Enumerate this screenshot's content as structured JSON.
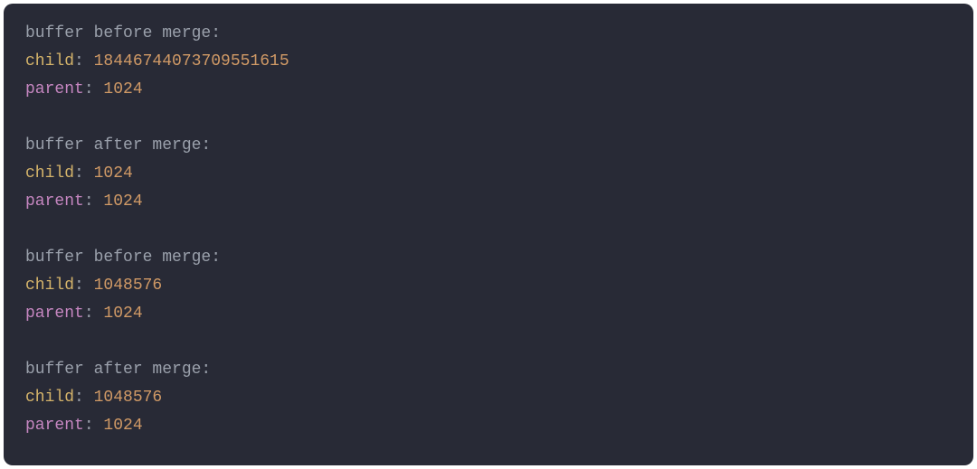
{
  "blocks": [
    {
      "heading": "buffer before merge:",
      "childKey": "child",
      "childValue": "18446744073709551615",
      "parentKey": "parent",
      "parentValue": "1024"
    },
    {
      "heading": "buffer after merge:",
      "childKey": "child",
      "childValue": "1024",
      "parentKey": "parent",
      "parentValue": "1024"
    },
    {
      "heading": "buffer before merge:",
      "childKey": "child",
      "childValue": "1048576",
      "parentKey": "parent",
      "parentValue": "1024"
    },
    {
      "heading": "buffer after merge:",
      "childKey": "child",
      "childValue": "1048576",
      "parentKey": "parent",
      "parentValue": "1024"
    }
  ],
  "separator": ": "
}
